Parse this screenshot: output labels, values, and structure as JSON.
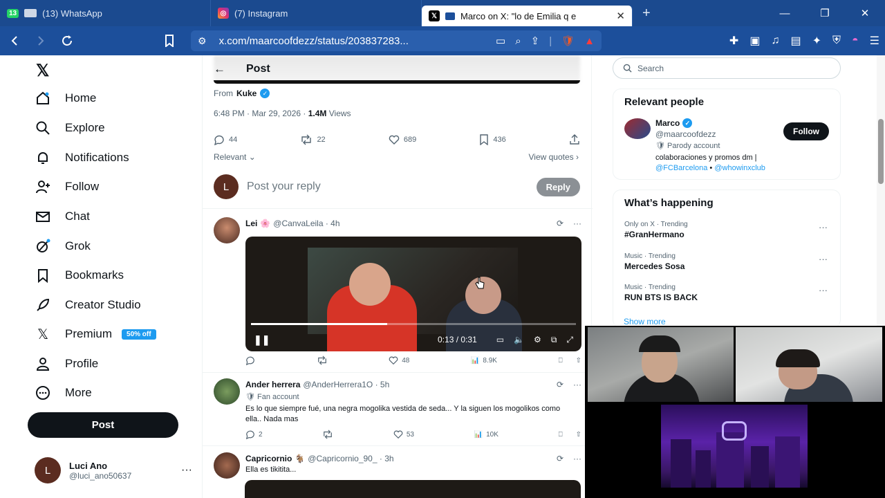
{
  "browser": {
    "tabs": [
      {
        "badge": "13",
        "title": "(13) WhatsApp",
        "icon": "whatsapp-icon"
      },
      {
        "title": "(7) Instagram",
        "icon": "instagram-icon"
      },
      {
        "title": "Marco on X: \"lo de Emilia q e",
        "icon": "x-icon",
        "active": true
      }
    ],
    "url": "x.com/maarcoofdezz/status/203837283..."
  },
  "sidebar": {
    "items": [
      {
        "label": "Home",
        "icon": "home-icon"
      },
      {
        "label": "Explore",
        "icon": "search-icon"
      },
      {
        "label": "Notifications",
        "icon": "bell-icon"
      },
      {
        "label": "Follow",
        "icon": "add-person-icon"
      },
      {
        "label": "Chat",
        "icon": "mail-icon"
      },
      {
        "label": "Grok",
        "icon": "grok-icon"
      },
      {
        "label": "Bookmarks",
        "icon": "bookmark-icon"
      },
      {
        "label": "Creator Studio",
        "icon": "rocket-icon"
      },
      {
        "label": "Premium",
        "icon": "x-icon"
      },
      {
        "label": "Profile",
        "icon": "person-icon"
      },
      {
        "label": "More",
        "icon": "more-circle-icon"
      }
    ],
    "premium_badge": "50% off",
    "post_button": "Post",
    "account": {
      "avatar_letter": "L",
      "name": "Luci Ano",
      "handle": "@luci_ano50637"
    }
  },
  "main": {
    "header_title": "Post",
    "from_label": "From",
    "from_name": "Kuke",
    "timestamp": "6:48 PM · Mar 29, 2026 · ",
    "views_count": "1.4M",
    "views_label": " Views",
    "stats": {
      "replies": "44",
      "reposts": "22",
      "likes": "689",
      "bookmarks": "436"
    },
    "relevant": "Relevant",
    "view_quotes": "View quotes",
    "reply_avatar_letter": "L",
    "reply_placeholder": "Post your reply",
    "reply_button": "Reply",
    "tweets": [
      {
        "name": "Lei",
        "handle": "@CanvaLeila · 4h",
        "video_time": "0:13 / 0:31",
        "video_progress": 0.42,
        "actions": {
          "likes": "48",
          "views": "8.9K"
        }
      },
      {
        "name": "Ander herrera",
        "handle": "@AnderHerrera1O · 5h",
        "sub": "Fan account",
        "text": "Es lo que siempre fué, una negra mogolika vestida de seda... Y la siguen los mogolikos como ella.. Nada mas",
        "actions": {
          "replies": "2",
          "likes": "53",
          "views": "10K"
        }
      },
      {
        "name": "Capricornio",
        "handle": "@Capricornio_90_ · 3h",
        "text": "Ella es tikitita..."
      }
    ]
  },
  "right": {
    "search_placeholder": "Search",
    "relevant_people_title": "Relevant people",
    "person": {
      "name": "Marco",
      "handle": "@maarcoofdezz",
      "parody": "Parody account",
      "bio": "colaboraciones y promos dm |",
      "link1": "@FCBarcelona",
      "bullet": " • ",
      "link2": "@whowinxclub",
      "follow": "Follow"
    },
    "happening_title": "What’s happening",
    "trends": [
      {
        "context": "Only on X · Trending",
        "name": "#GranHermano"
      },
      {
        "context": "Music · Trending",
        "name": "Mercedes Sosa"
      },
      {
        "context": "Music · Trending",
        "name": "RUN BTS IS BACK"
      }
    ],
    "show_more": "Show more"
  },
  "colors": {
    "accent": "#1d9bf0",
    "chrome": "#1c4f9b",
    "dark": "#0f1419"
  }
}
